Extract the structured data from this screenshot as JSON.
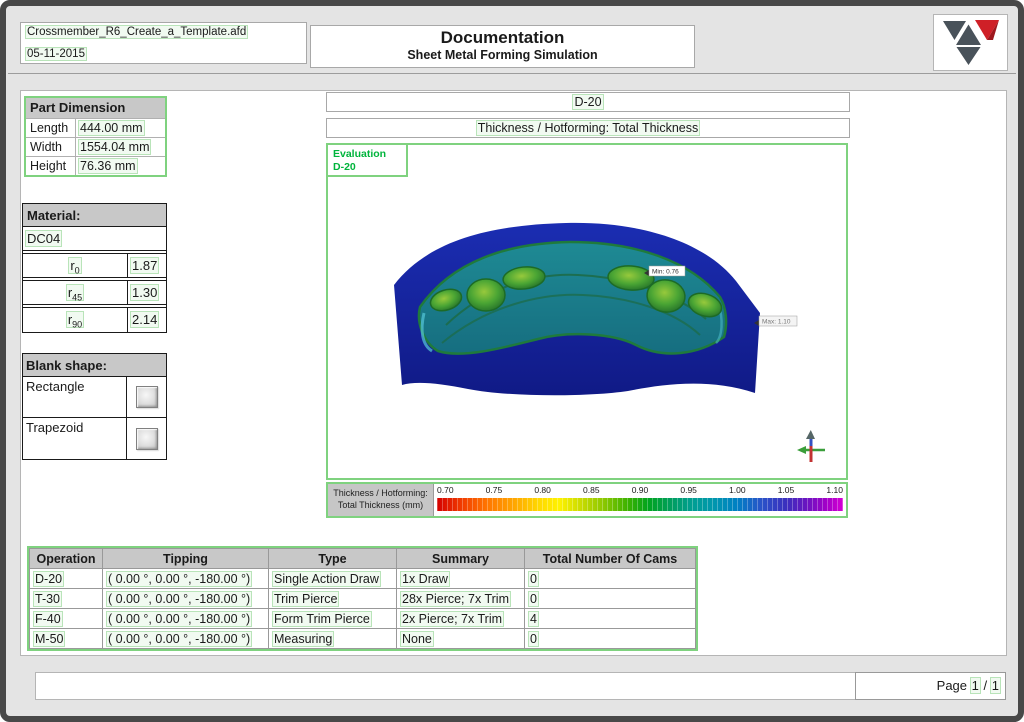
{
  "header": {
    "file_name": "Crossmember_R6_Create_a_Template.afd",
    "date": "05-11-2015",
    "title": "Documentation",
    "subtitle": "Sheet Metal Forming Simulation"
  },
  "part_dimension": {
    "title": "Part Dimension",
    "rows": [
      {
        "label": "Length",
        "value": "444.00 mm"
      },
      {
        "label": "Width",
        "value": "1554.04 mm"
      },
      {
        "label": "Height",
        "value": "76.36 mm"
      }
    ]
  },
  "material": {
    "title": "Material:",
    "name": "DC04",
    "rows": [
      {
        "label": "r",
        "sub": "0",
        "value": "1.87"
      },
      {
        "label": "r",
        "sub": "45",
        "value": "1.30"
      },
      {
        "label": "r",
        "sub": "90",
        "value": "2.14"
      }
    ]
  },
  "blank_shape": {
    "title": "Blank shape:",
    "options": [
      {
        "label": "Rectangle",
        "checked": false
      },
      {
        "label": "Trapezoid",
        "checked": false
      }
    ]
  },
  "result": {
    "operation": "D-20",
    "result_title": "Thickness / Hotforming: Total Thickness",
    "evaluation_label": "Evaluation",
    "evaluation_operation": "D-20",
    "min_annotation": "Min: 0.76",
    "max_annotation": "Max: 1.10"
  },
  "legend": {
    "label_line1": "Thickness / Hotforming:",
    "label_line2": "Total Thickness (mm)",
    "ticks": [
      "0.70",
      "0.75",
      "0.80",
      "0.85",
      "0.90",
      "0.95",
      "1.00",
      "1.05",
      "1.10"
    ]
  },
  "operations_table": {
    "headers": [
      "Operation",
      "Tipping",
      "Type",
      "Summary",
      "Total Number Of Cams"
    ],
    "rows": [
      [
        "D-20",
        "( 0.00 °, 0.00 °, -180.00 °)",
        "Single Action Draw",
        "1x Draw",
        "0"
      ],
      [
        "T-30",
        "( 0.00 °, 0.00 °, -180.00 °)",
        "Trim Pierce",
        "28x Pierce; 7x Trim",
        "0"
      ],
      [
        "F-40",
        "( 0.00 °, 0.00 °, -180.00 °)",
        "Form Trim Pierce",
        "2x Pierce; 7x Trim",
        "4"
      ],
      [
        "M-50",
        "( 0.00 °, 0.00 °, -180.00 °)",
        "Measuring",
        "None",
        "0"
      ]
    ]
  },
  "footer": {
    "page_label": "Page",
    "current_page": "1",
    "separator": "/",
    "total_pages": "1"
  },
  "icons": {
    "logo": "autoform-triangles-logo",
    "axis": "view-orientation-axis-icon",
    "checkbox": "3d-beveled-checkbox"
  },
  "colors": {
    "accent_green_border": "#7fd27f",
    "highlight_green": "#f1faf1",
    "table_header_gray": "#c8c8c8",
    "evaluation_text_green": "#00b43c",
    "frame_gray": "#484848",
    "part_outer_blue": "#17219e",
    "part_inner_teal": "#1f8d96",
    "logo_red": "#cf2027",
    "logo_gray": "#49525a"
  }
}
